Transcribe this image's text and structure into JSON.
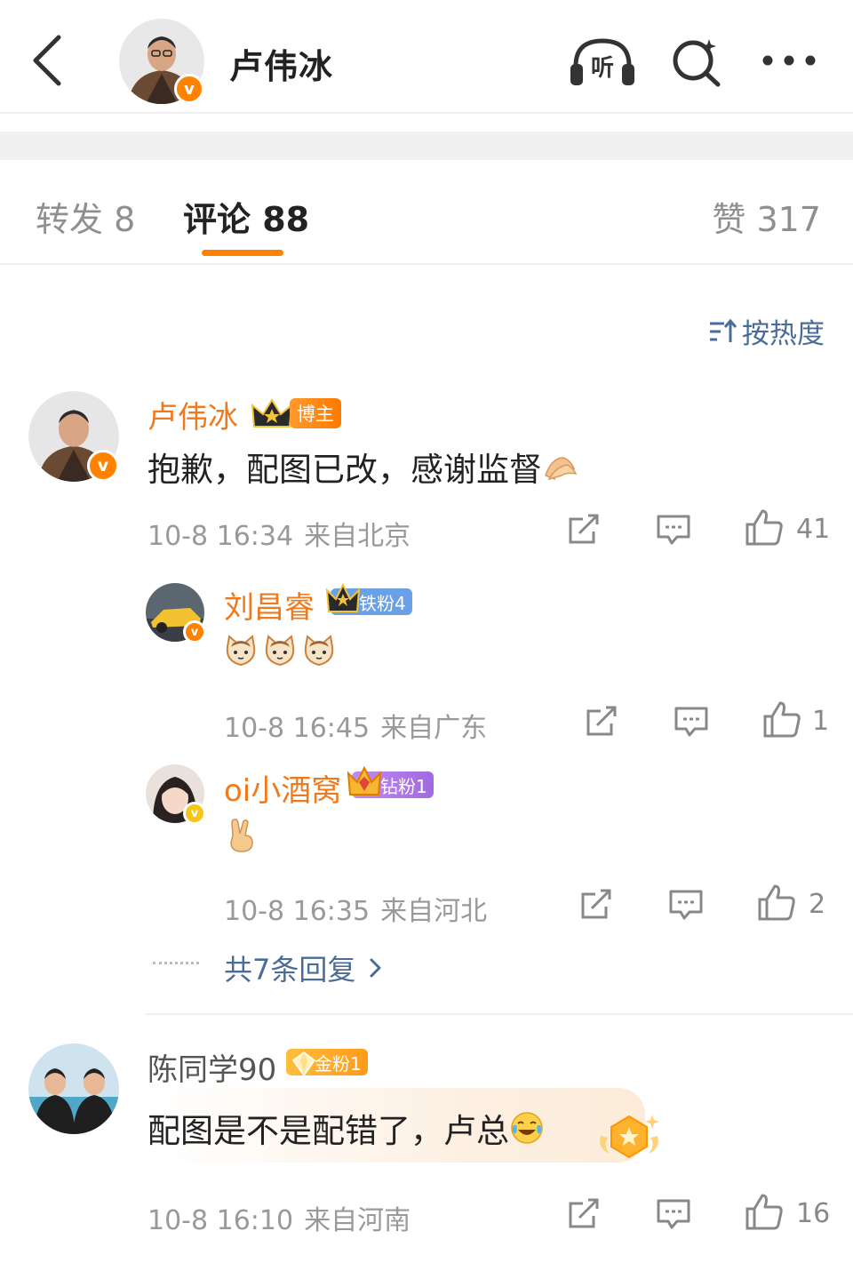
{
  "header": {
    "name": "卢伟冰",
    "listen_label": "听"
  },
  "tabs": {
    "repost": "转发 8",
    "comment": "评论 88",
    "like": "赞 317"
  },
  "sort": {
    "label": "按热度"
  },
  "comments": [
    {
      "user": "卢伟冰",
      "badge": "博主",
      "text": "抱歉，配图已改，感谢监督",
      "time": "10-8 16:34",
      "location": "来自北京",
      "likes": "41"
    },
    {
      "user": "刘昌睿",
      "badge": "铁粉4",
      "time": "10-8 16:45",
      "location": "来自广东",
      "likes": "1"
    },
    {
      "user": "oi小酒窝",
      "badge": "钻粉1",
      "time": "10-8 16:35",
      "location": "来自河北",
      "likes": "2"
    },
    {
      "user": "陈同学90",
      "badge": "金粉1",
      "text": "配图是不是配错了，卢总",
      "time": "10-8 16:10",
      "location": "来自河南",
      "likes": "16"
    }
  ],
  "more_replies": "共7条回复",
  "colors": {
    "accent": "#ff8200",
    "username": "#ef7a1e",
    "link": "#4a6c97"
  }
}
